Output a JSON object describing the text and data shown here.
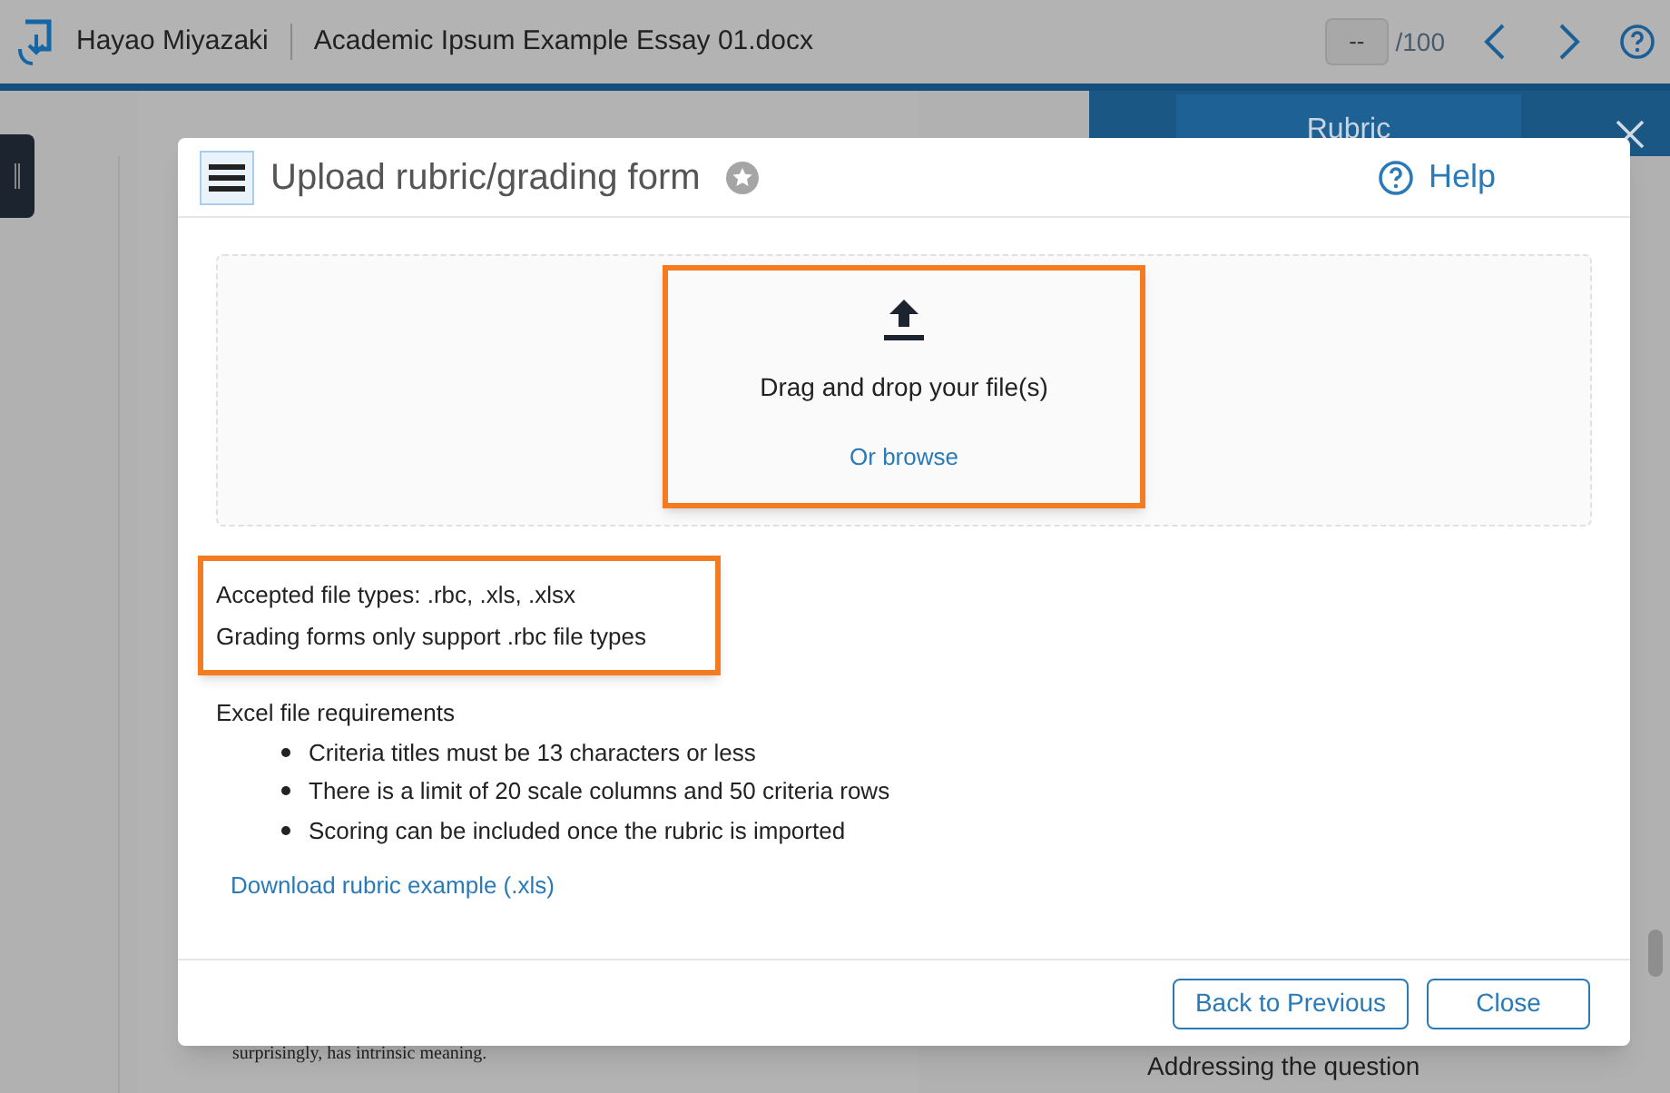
{
  "app_bar": {
    "user_name": "Hayao Miyazaki",
    "document_title": "Academic Ipsum Example Essay 01.docx",
    "page_field": "--",
    "page_total": "/100"
  },
  "side_panel": {
    "tab": "Rubric",
    "item": "Addressing the question"
  },
  "document": {
    "text_line": "surprisingly, has intrinsic meaning."
  },
  "dialog": {
    "title": "Upload rubric/grading form",
    "help": "Help",
    "dropzone": {
      "prompt": "Drag and drop your file(s)",
      "browse_link": "Or browse"
    },
    "accepted_lines": [
      "Accepted file types: .rbc, .xls, .xlsx",
      "Grading forms only support .rbc file types"
    ],
    "requirements_title": "Excel file requirements",
    "requirements": [
      "Criteria titles must be 13 characters or less",
      "There is a limit of 20 scale columns and 50 criteria rows",
      "Scoring can be included once the rubric is imported"
    ],
    "download_link": "Download rubric example (.xls)",
    "buttons": [
      "Back to Previous",
      "Close"
    ]
  }
}
